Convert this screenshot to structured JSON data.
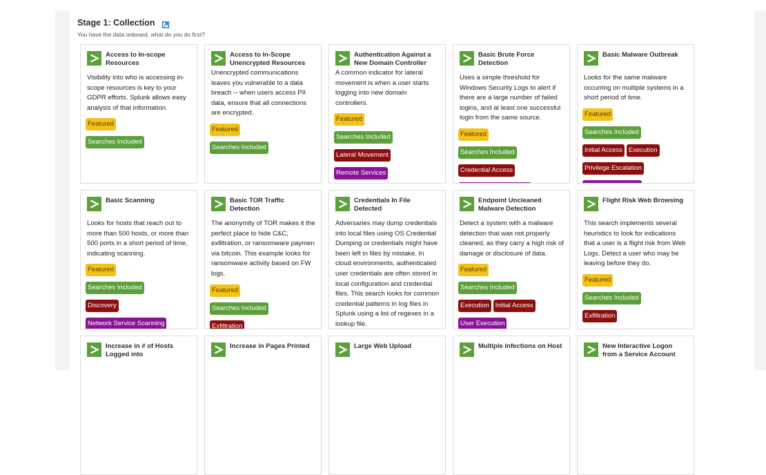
{
  "stage": {
    "title": "Stage 1: Collection",
    "subtitle": "You have the data onboard, what do you do first?",
    "link_icon": "external-link-icon"
  },
  "colors": {
    "icon_green": "#5ca03c",
    "featured": "#f2c21b",
    "searches_included": "#5ca03c",
    "tactic": "#8c0e0e",
    "technique": "#8a1297"
  },
  "cards": [
    {
      "title": "Access to In-scope Resources",
      "description": "Visibility into who is accessing in-scope resources is key to your GDPR efforts. Splunk allows easy analysis of that information.",
      "tags": [
        {
          "label": "Featured",
          "type": "featured"
        },
        {
          "label": "Searches Included",
          "type": "searches"
        }
      ]
    },
    {
      "title": "Access to In-Scope Unencrypted Resources",
      "description": "Unencrypted communications leaves you vulnerable to a data breach -- when users access PII data, ensure that all connections are encrypted.",
      "tags": [
        {
          "label": "Featured",
          "type": "featured"
        },
        {
          "label": "Searches Included",
          "type": "searches"
        }
      ]
    },
    {
      "title": "Authentication Against a New Domain Controller",
      "description": "A common indicator for lateral movement is when a user starts logging into new domain controllers.",
      "tags": [
        {
          "label": "Featured",
          "type": "featured"
        },
        {
          "label": "Searches Included",
          "type": "searches"
        },
        {
          "label": "Lateral Movement",
          "type": "tactic"
        },
        {
          "label": "Remote Services",
          "type": "technique"
        }
      ]
    },
    {
      "title": "Basic Brute Force Detection",
      "description": "Uses a simple threshold for Windows Security Logs to alert if there are a large number of failed logins, and at least one successful login from the same source.",
      "tags": [
        {
          "label": "Featured",
          "type": "featured"
        },
        {
          "label": "Searches Included",
          "type": "searches"
        },
        {
          "label": "Credential Access",
          "type": "tactic"
        },
        {
          "label": "",
          "type": "technique"
        }
      ]
    },
    {
      "title": "Basic Malware Outbreak",
      "description": "Looks for the same malware occurring on multiple systems in a short period of time.",
      "tags": [
        {
          "label": "Featured",
          "type": "featured"
        },
        {
          "label": "Searches Included",
          "type": "searches"
        },
        {
          "label": "Initial Access",
          "type": "tactic",
          "inline": true
        },
        {
          "label": "Execution",
          "type": "tactic",
          "inline": true
        },
        {
          "label": "Privilege Escalation",
          "type": "tactic"
        },
        {
          "label": "",
          "type": "technique"
        }
      ]
    },
    {
      "title": "Basic Scanning",
      "description": "Looks for hosts that reach out to more than 500 hosts, or more than 500 ports in a short period of time, indicating scanning.",
      "tags": [
        {
          "label": "Featured",
          "type": "featured"
        },
        {
          "label": "Searches Included",
          "type": "searches"
        },
        {
          "label": "Discovery",
          "type": "tactic"
        },
        {
          "label": "Network Service Scanning",
          "type": "technique"
        }
      ]
    },
    {
      "title": "Basic TOR Traffic Detection",
      "description": "The anonymity of TOR makes it the perfect place to hide C&C, exfiltration, or ransomware paymen via bitcoin. This example looks for ransomware activity based on FW logs.",
      "tags": [
        {
          "label": "Featured",
          "type": "featured"
        },
        {
          "label": "Searches Included",
          "type": "searches"
        },
        {
          "label": "Exfiltration",
          "type": "tactic"
        }
      ]
    },
    {
      "title": "Credentials In File Detected",
      "description": "Adversaries may dump credentials into local files using OS Credential Dumping or credentials might have been left in files by mistake. In cloud environments, authenticated user credentials are often stored in local configuration and credential files. This search looks for common credential patterns in log files in Splunk using a list of regexes in a lookup file.",
      "tags": []
    },
    {
      "title": "Endpoint Uncleaned Malware Detection",
      "description": "Detect a system with a malware detection that was not properly cleaned, as they carry a high risk of damage or disclosure of data.",
      "tags": [
        {
          "label": "Featured",
          "type": "featured"
        },
        {
          "label": "Searches Included",
          "type": "searches"
        },
        {
          "label": "Execution",
          "type": "tactic",
          "inline": true
        },
        {
          "label": "Initial Access",
          "type": "tactic",
          "inline": true
        },
        {
          "label": "User Execution",
          "type": "technique"
        }
      ]
    },
    {
      "title": "Flight Risk Web Browsing",
      "description": "This search implements several heuristics to look for indications that a user is a flight risk from Web Logs. Detect a user who may be leaving before they do.",
      "tags": [
        {
          "label": "Featured",
          "type": "featured"
        },
        {
          "label": "Searches Included",
          "type": "searches"
        },
        {
          "label": "Exfiltration",
          "type": "tactic"
        }
      ]
    },
    {
      "title": "Increase in # of Hosts Logged into",
      "description": "",
      "tags": []
    },
    {
      "title": "Increase in Pages Printed",
      "description": "",
      "tags": []
    },
    {
      "title": "Large Web Upload",
      "description": "",
      "tags": []
    },
    {
      "title": "Multiple Infections on Host",
      "description": "",
      "tags": []
    },
    {
      "title": "New Interactive Logon from a Service Account",
      "description": "",
      "tags": []
    }
  ]
}
